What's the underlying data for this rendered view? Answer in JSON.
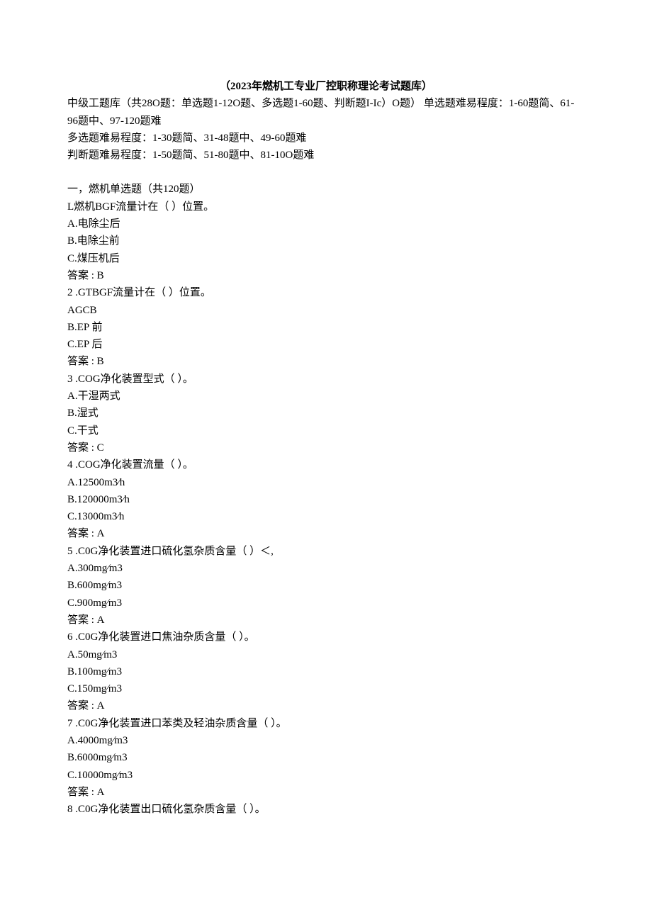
{
  "title": "（2023年燃机工专业厂控职称理论考试题库）",
  "intro": [
    "中级工题库（共28O题：单选题1-12O题、多选题1-60题、判断题I-Ic）O题）  单选题难易程度：1-60题简、61-96题中、97-120题难",
    "多选题难易程度：1-30题简、31-48题中、49-60题难",
    "判断题难易程度：1-50题简、51-80题中、81-10O题难"
  ],
  "section_header": "一，燃机单选题（共120题）",
  "lines": [
    "L燃机BGF流量计在（ ）位置。",
    "A.电除尘后",
    "B.电除尘前",
    "C.煤压机后",
    "答案 : B",
    "2   .GTBGF流量计在（ ）位置。",
    "AGCB",
    "B.EP 前",
    "C.EP 后",
    "答案 : B",
    "3   .COG净化装置型式（ ）。",
    "A.干湿两式",
    "B.湿式",
    "C.干式",
    "答案 : C",
    "4   .COG净化装置流量（ ）。",
    "A.12500m3∕h",
    "B.120000m3∕h",
    "C.13000m3∕h",
    "答案 : A",
    "5   .C0G净化装置进口硫化氢杂质含量（ ）＜,",
    "A.300mg∕m3",
    "B.600mg∕m3",
    "C.900mg∕m3",
    "答案 : A",
    "6   .C0G净化装置进口焦油杂质含量（ ）。",
    "A.50mg∕m3",
    "B.100mg∕m3",
    "C.150mg∕m3",
    "答案 : A",
    "7   .C0G净化装置进口苯类及轻油杂质含量（ ）。",
    "A.4000mg∕m3",
    "B.6000mg∕m3",
    "C.10000mg∕m3",
    "答案 : A",
    "8   .C0G净化装置出口硫化氢杂质含量（ ）。"
  ]
}
